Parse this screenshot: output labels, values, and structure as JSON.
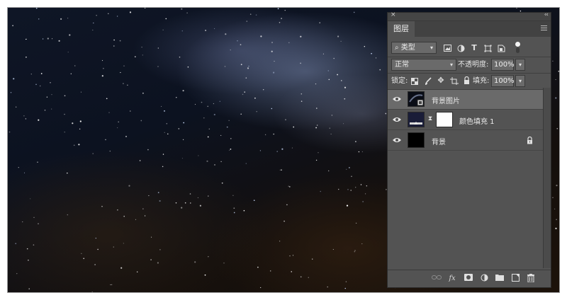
{
  "panel": {
    "close_glyph": "×",
    "collapse_glyph": "‹‹",
    "tab_label": "图层"
  },
  "filter": {
    "kind_label": "类型",
    "icons": [
      "image-filter-icon",
      "adjustment-filter-icon",
      "type-filter-icon",
      "shape-filter-icon",
      "smart-object-filter-icon",
      "filter-toggle-icon"
    ]
  },
  "blend": {
    "mode": "正常",
    "opacity_label": "不透明度:",
    "opacity_value": "100%"
  },
  "lock": {
    "label": "锁定:",
    "icons": [
      "lock-transparent-icon",
      "lock-paint-icon",
      "lock-position-icon",
      "lock-artboard-icon",
      "lock-all-icon"
    ],
    "fill_label": "填充:",
    "fill_value": "100%"
  },
  "layers": [
    {
      "name": "背景图片",
      "type": "smart-object",
      "selected": true
    },
    {
      "name": "颜色填充 1",
      "type": "fill",
      "selected": false,
      "fill_color": "#ffffff",
      "thumb_color": "#1a1d38"
    },
    {
      "name": "背景",
      "type": "background",
      "selected": false,
      "locked": true,
      "thumb_color": "#000000"
    }
  ],
  "footer": {
    "icons": [
      "link-layers-icon",
      "layer-style-icon",
      "add-mask-icon",
      "new-adjustment-icon",
      "new-group-icon",
      "new-layer-icon",
      "delete-layer-icon"
    ],
    "fx_label": "fx"
  },
  "colors": {
    "panel_bg": "#535353",
    "selected_row": "#6a6a6a"
  }
}
